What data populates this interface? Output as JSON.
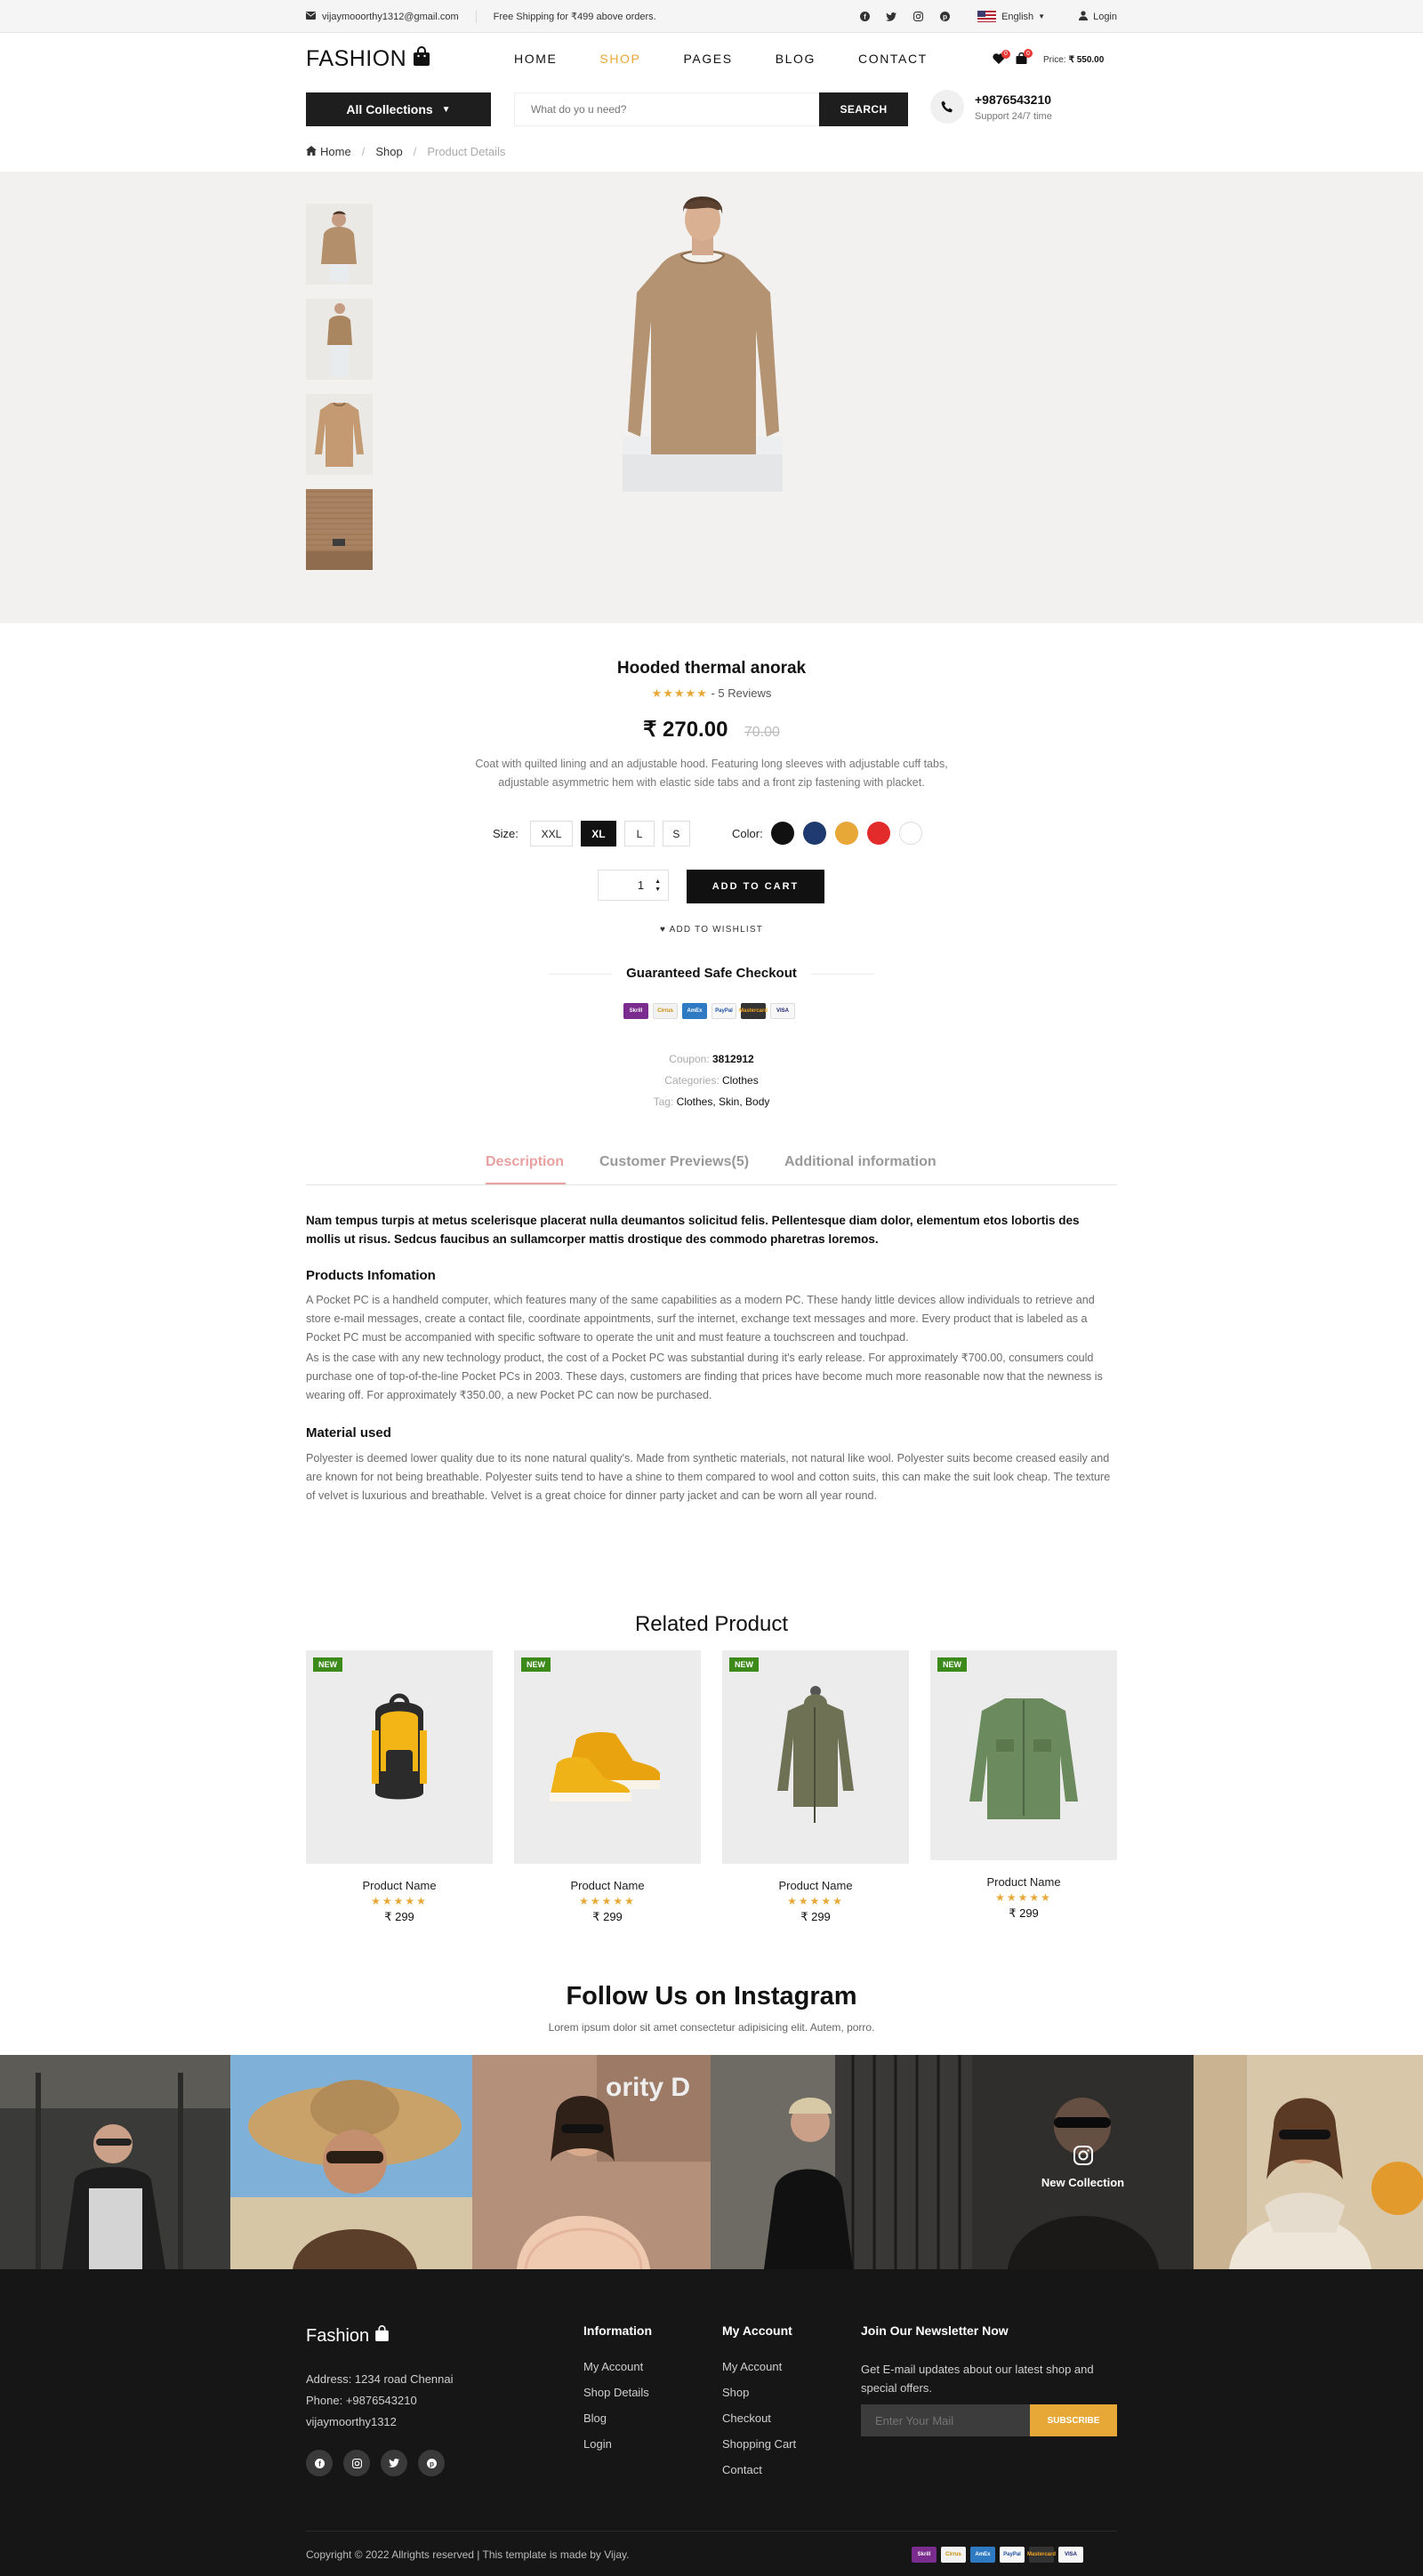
{
  "topbar": {
    "email": "vijaymooorthy1312@gmail.com",
    "shipping": "Free Shipping for ₹499 above orders.",
    "language": "English",
    "login": "Login"
  },
  "header": {
    "logo": "FASHION",
    "nav": [
      {
        "label": "HOME"
      },
      {
        "label": "SHOP",
        "active": true
      },
      {
        "label": "PAGES"
      },
      {
        "label": "BLOG"
      },
      {
        "label": "CONTACT"
      }
    ],
    "wishlist_count": "0",
    "cart_count": "0",
    "price_label": "Price:",
    "price_value": "₹ 550.00",
    "all_collections": "All Collections",
    "search_placeholder": "What do yo u need?",
    "search_button": "SEARCH",
    "phone": "+9876543210",
    "support": "Support 24/7 time"
  },
  "breadcrumb": {
    "home": "Home",
    "shop": "Shop",
    "current": "Product Details"
  },
  "product": {
    "title": "Hooded thermal anorak",
    "stars": "★★★★★",
    "reviews": " - 5 Reviews",
    "price": "₹ 270.00",
    "old_price": "70.00",
    "description": "Coat with quilted lining and an adjustable hood. Featuring long sleeves with adjustable cuff tabs, adjustable asymmetric hem with elastic side tabs and a front zip fastening with placket.",
    "size_label": "Size:",
    "sizes": [
      "XXL",
      "XL",
      "L",
      "S"
    ],
    "selected_size": "XL",
    "color_label": "Color:",
    "colors": [
      "#111111",
      "#1f3a6e",
      "#e8a838",
      "#e32b2b",
      "#ffffff"
    ],
    "quantity": "1",
    "add_to_cart": "ADD TO CART",
    "add_to_wishlist": "ADD TO WISHLIST",
    "safe_checkout": "Guaranteed Safe Checkout",
    "payment_methods": [
      "Skrill",
      "Cirrus",
      "AmEx",
      "PayPal",
      "Mastercard",
      "VISA"
    ],
    "coupon_label": "Coupon:",
    "coupon_value": "3812912",
    "categories_label": "Categories:",
    "categories_value": "Clothes",
    "tag_label": "Tag:",
    "tag_value": "Clothes, Skin, Body"
  },
  "tabs": [
    {
      "label": "Description",
      "active": true
    },
    {
      "label": "Customer Previews(5)"
    },
    {
      "label": "Additional information"
    }
  ],
  "description": {
    "lead": "Nam tempus turpis at metus scelerisque placerat nulla deumantos solicitud felis. Pellentesque diam dolor, elementum etos lobortis des mollis ut risus. Sedcus faucibus an sullamcorper mattis drostique des commodo pharetras loremos.",
    "info_heading": "Products Infomation",
    "info_p1": "A Pocket PC is a handheld computer, which features many of the same capabilities as a modern PC. These handy little devices allow individuals to retrieve and store e-mail messages, create a contact file, coordinate appointments, surf the internet, exchange text messages and more. Every product that is labeled as a Pocket PC must be accompanied with specific software to operate the unit and must feature a touchscreen and touchpad.",
    "info_p2": "As is the case with any new technology product, the cost of a Pocket PC was substantial during it's early release. For approximately ₹700.00, consumers could purchase one of top-of-the-line Pocket PCs in 2003. These days, customers are finding that prices have become much more reasonable now that the newness is wearing off. For approximately ₹350.00, a new Pocket PC can now be purchased.",
    "material_heading": "Material used",
    "material_p": "Polyester is deemed lower quality due to its none natural quality's. Made from synthetic materials, not natural like wool. Polyester suits become creased easily and are known for not being breathable. Polyester suits tend to have a shine to them compared to wool and cotton suits, this can make the suit look cheap. The texture of velvet is luxurious and breathable. Velvet is a great choice for dinner party jacket and can be worn all year round."
  },
  "related": {
    "title": "Related Product",
    "items": [
      {
        "badge": "NEW",
        "name": "Product Name",
        "stars": "★★★★★",
        "price": "₹ 299",
        "icon": "backpack-image"
      },
      {
        "badge": "NEW",
        "name": "Product Name",
        "stars": "★★★★★",
        "price": "₹ 299",
        "icon": "sneaker-image"
      },
      {
        "badge": "NEW",
        "name": "Product Name",
        "stars": "★★★★★",
        "price": "₹ 299",
        "icon": "hooded-jacket-image"
      },
      {
        "badge": "NEW",
        "name": "Product Name",
        "stars": "★★★★★",
        "price": "₹ 299",
        "icon": "green-jacket-image"
      }
    ]
  },
  "instagram": {
    "title": "Follow Us on Instagram",
    "subtitle": "Lorem ipsum dolor sit amet consectetur adipisicing elit. Autem, porro.",
    "overlay": "New Collection"
  },
  "footer": {
    "logo": "Fashion",
    "address": "Address: 1234 road Chennai",
    "phone": "Phone: +9876543210",
    "email": "vijaymoorthy1312",
    "info_heading": "Information",
    "info_links": [
      "My Account",
      "Shop Details",
      "Blog",
      "Login"
    ],
    "account_heading": "My Account",
    "account_links": [
      "My Account",
      "Shop",
      "Checkout",
      "Shopping Cart",
      "Contact"
    ],
    "newsletter_heading": "Join Our Newsletter Now",
    "newsletter_text": "Get E-mail updates about our latest shop and special offers.",
    "newsletter_placeholder": "Enter Your Mail",
    "subscribe": "SUBSCRIBE",
    "copyright": "Copyright © 2022 Allrights reserved | This template is made by Vijay."
  }
}
